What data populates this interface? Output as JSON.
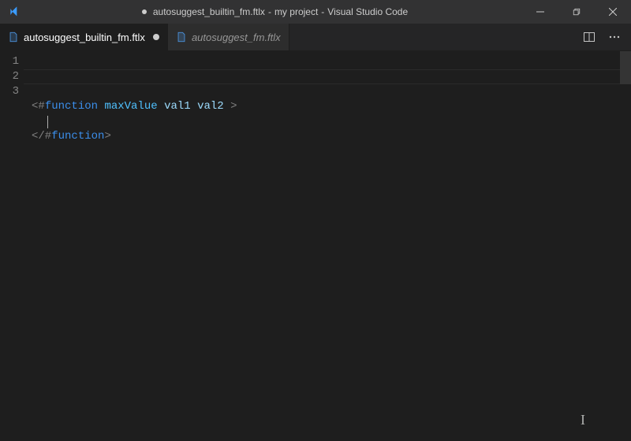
{
  "titlebar": {
    "dirty": true,
    "filename": "autosuggest_builtin_fm.ftlx",
    "project": "my project",
    "app": "Visual Studio Code"
  },
  "tabs": [
    {
      "label": "autosuggest_builtin_fm.ftlx",
      "active": true,
      "dirty": true
    },
    {
      "label": "autosuggest_fm.ftlx",
      "active": false,
      "dirty": false
    }
  ],
  "editor": {
    "lines": [
      {
        "num": "1",
        "tokens": [
          {
            "t": "<#",
            "c": "delim"
          },
          {
            "t": "function",
            "c": "key"
          },
          {
            "t": " ",
            "c": ""
          },
          {
            "t": "maxValue",
            "c": "fn"
          },
          {
            "t": " ",
            "c": ""
          },
          {
            "t": "val1",
            "c": "param"
          },
          {
            "t": " ",
            "c": ""
          },
          {
            "t": "val2",
            "c": "param"
          },
          {
            "t": " >",
            "c": "delim"
          }
        ]
      },
      {
        "num": "2",
        "tokens": []
      },
      {
        "num": "3",
        "tokens": [
          {
            "t": "</#",
            "c": "delim"
          },
          {
            "t": "function",
            "c": "key"
          },
          {
            "t": ">",
            "c": "delim"
          }
        ]
      }
    ],
    "current_line_index": 1
  }
}
